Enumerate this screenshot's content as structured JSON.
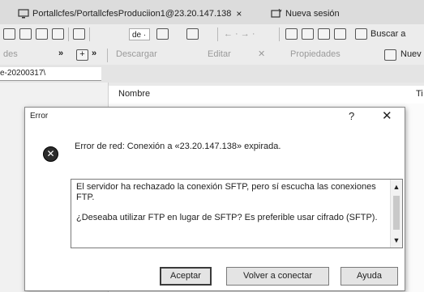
{
  "tabs": {
    "active_label": "Portallcfes/PortallcfesProduciion1@23.20.147.138",
    "close_glyph": "×",
    "new_session_label": "Nueva sesión"
  },
  "toolbar1": {
    "combo_value": "de ·",
    "search_label": "Buscar a"
  },
  "toolbar2": {
    "left_stub": "des",
    "chevrons": "»",
    "plus_glyph": "+",
    "download_label": "Descargar",
    "edit_label": "Editar",
    "delete_glyph": "✕",
    "properties_label": "Propiedades",
    "new_label": "Nuev"
  },
  "pathbar": {
    "path": "e-20200317\\"
  },
  "filelist": {
    "col_name": "Nombre",
    "col_next": "Ti"
  },
  "dialog": {
    "title": "Error",
    "help_glyph": "?",
    "close_glyph": "✕",
    "icon_glyph": "✕",
    "message": "Error de red: Conexión a «23.20.147.138» expirada.",
    "detail_paragraph_1": "El servidor ha rechazado la conexión SFTP, pero sí escucha las conexiones FTP.",
    "detail_paragraph_2": "¿Deseaba utilizar FTP en lugar de SFTP? Es preferible usar cifrado (SFTP).",
    "scroll_up": "▲",
    "scroll_down": "▼",
    "buttons": {
      "accept": "Aceptar",
      "reconnect": "Volver a conectar",
      "help": "Ayuda"
    }
  }
}
